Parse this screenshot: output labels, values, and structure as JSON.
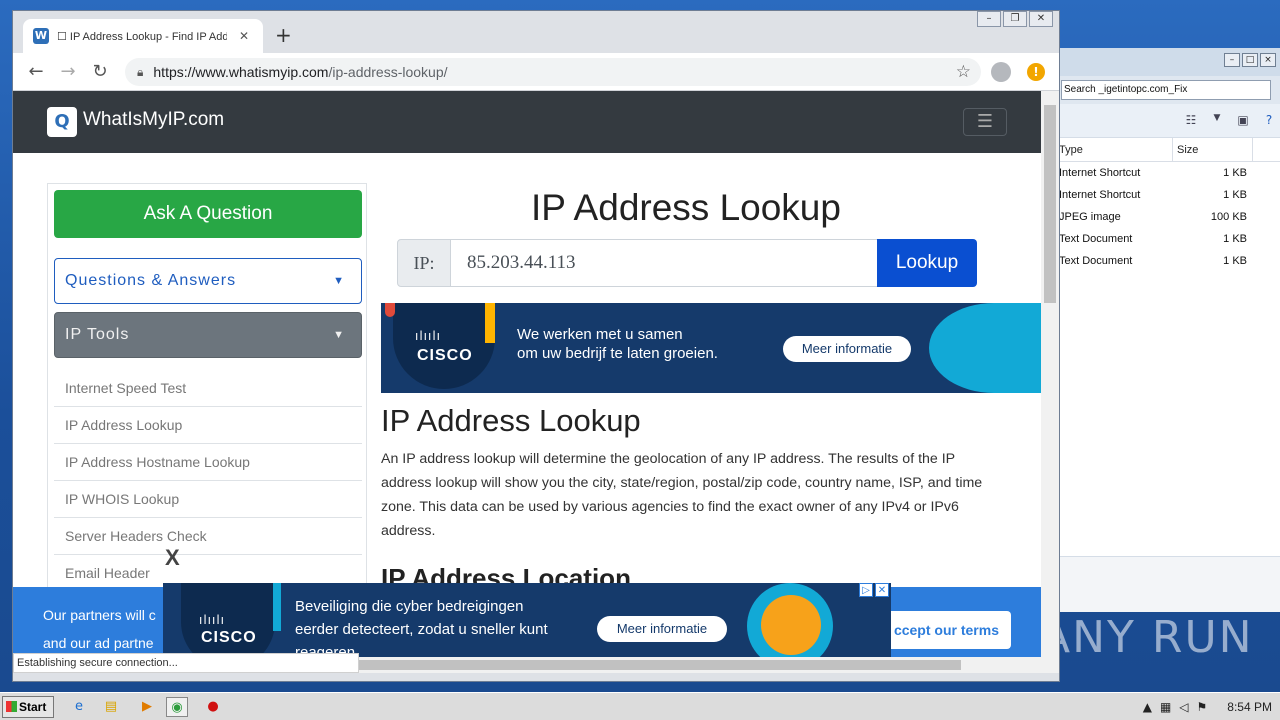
{
  "browser": {
    "tab_title": "☐ IP Address Lookup - Find IP Addre",
    "url_main": "https://www.whatismyip.com",
    "url_path": "/ip-address-lookup/",
    "status": "Establishing secure connection..."
  },
  "site": {
    "logo_text": "WhatIsMyIP.com"
  },
  "sidebar": {
    "ask_label": "Ask A Question",
    "qa_label": "Questions & Answers",
    "tools_label": "IP Tools",
    "items": [
      {
        "label": "Internet Speed Test"
      },
      {
        "label": "IP Address Lookup"
      },
      {
        "label": "IP Address Hostname Lookup"
      },
      {
        "label": "IP WHOIS Lookup"
      },
      {
        "label": "Server Headers Check"
      },
      {
        "label": "Email Header"
      }
    ]
  },
  "lookup": {
    "title": "IP Address Lookup",
    "ip_label": "IP:",
    "ip_value": "85.203.44.113",
    "button": "Lookup"
  },
  "ad_top": {
    "line1": "We werken met u samen",
    "line2": "om uw bedrijf te laten groeien.",
    "cta": "Meer informatie",
    "brand": "CISCO"
  },
  "article": {
    "heading": "IP Address Lookup",
    "body": "An IP address lookup will determine the geolocation of any IP address. The results of the IP address lookup will show you the city, state/region, postal/zip code, country name, ISP, and time zone. This data can be used by various agencies to find the exact owner of any IPv4 or IPv6 address.",
    "subheading_partial": "IP Address Location"
  },
  "cookie": {
    "line1": "Our partners will c",
    "line2": "and our ad partne",
    "accept": "ccept our terms"
  },
  "ad_bottom": {
    "line1": "Beveiliging die cyber bedreigingen",
    "line2": "eerder detecteert, zodat u sneller kunt",
    "line3": "reageren.",
    "cta": "Meer informatie",
    "brand": "CISCO",
    "close": "X"
  },
  "explorer": {
    "search": "Search _igetintopc.com_Fix",
    "col_type": "Type",
    "col_size": "Size",
    "rows": [
      {
        "type": "Internet Shortcut",
        "size": "1 KB"
      },
      {
        "type": "Internet Shortcut",
        "size": "1 KB"
      },
      {
        "type": "JPEG image",
        "size": "100 KB"
      },
      {
        "type": "Text Document",
        "size": "1 KB"
      },
      {
        "type": "Text Document",
        "size": "1 KB"
      }
    ]
  },
  "watermark": "ANY RUN",
  "taskbar": {
    "start": "Start",
    "clock": "8:54 PM"
  }
}
